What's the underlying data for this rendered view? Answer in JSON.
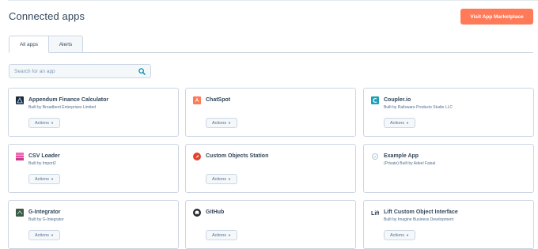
{
  "page": {
    "title": "Connected apps"
  },
  "header": {
    "marketplace_button": "Visit App Marketplace"
  },
  "tabs": [
    {
      "label": "All apps",
      "active": true
    },
    {
      "label": "Alerts",
      "active": false
    }
  ],
  "search": {
    "placeholder": "Search for an app",
    "value": ""
  },
  "apps": [
    {
      "name": "Appendum Finance Calculator",
      "builder": "Built by Broadbent Enterprises Limited",
      "actions_label": "Actions",
      "icon": "appendum-logo-icon"
    },
    {
      "name": "ChatSpot",
      "builder": "",
      "actions_label": "Actions",
      "icon": "chatspot-logo-icon"
    },
    {
      "name": "Coupler.io",
      "builder": "Built by Railsware Products Studio LLC",
      "actions_label": "Actions",
      "icon": "coupler-logo-icon"
    },
    {
      "name": "CSV Loader",
      "builder": "Built by Import2",
      "actions_label": "Actions",
      "icon": "csv-loader-logo-icon"
    },
    {
      "name": "Custom Objects Station",
      "builder": "",
      "actions_label": "Actions",
      "icon": "custom-objects-logo-icon"
    },
    {
      "name": "Example App",
      "builder": "(Private) Built by Adeel Faisal",
      "actions_label": "",
      "icon": "example-app-logo-icon"
    },
    {
      "name": "G-Integrator",
      "builder": "Built by G-Integrator",
      "actions_label": "Actions",
      "icon": "g-integrator-logo-icon"
    },
    {
      "name": "GitHub",
      "builder": "",
      "actions_label": "Actions",
      "icon": "github-logo-icon"
    },
    {
      "name": "Lift Custom Object Interface",
      "builder": "Built by Imagine Business Development",
      "actions_label": "Actions",
      "icon": "lift-logo-icon"
    }
  ],
  "colors": {
    "accent": "#ff7a59",
    "text": "#33475b",
    "border": "#cbd6e2",
    "search_icon": "#0091ae"
  }
}
